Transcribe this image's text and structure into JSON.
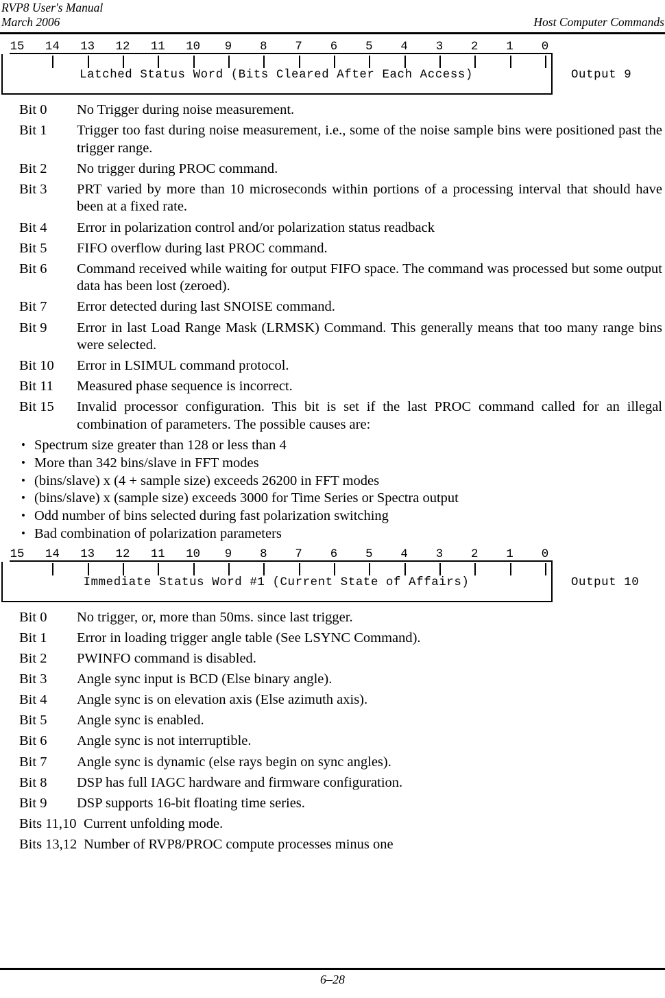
{
  "header": {
    "manual_title": "RVP8 User's Manual",
    "date": "March 2006",
    "section": "Host Computer Commands"
  },
  "footer": {
    "page_number": "6–28"
  },
  "diagram1": {
    "bit_numbers": [
      "15",
      "14",
      "13",
      "12",
      "11",
      "10",
      "9",
      "8",
      "7",
      "6",
      "5",
      "4",
      "3",
      "2",
      "1",
      "0"
    ],
    "label": "Latched Status Word (Bits Cleared After Each Access)",
    "output": "Output 9"
  },
  "diagram2": {
    "bit_numbers": [
      "15",
      "14",
      "13",
      "12",
      "11",
      "10",
      "9",
      "8",
      "7",
      "6",
      "5",
      "4",
      "3",
      "2",
      "1",
      "0"
    ],
    "label": "Immediate Status Word #1 (Current State of Affairs)",
    "output": "Output 10"
  },
  "latched_status_bits": [
    {
      "label": "Bit 0",
      "desc": "No Trigger during noise measurement."
    },
    {
      "label": "Bit 1",
      "desc": "Trigger too fast during noise measurement, i.e., some of the noise sample bins were positioned past the trigger range."
    },
    {
      "label": "Bit 2",
      "desc": "No trigger during PROC command."
    },
    {
      "label": "Bit 3",
      "desc": "PRT varied by more than 10 microseconds within portions of a processing interval that should have been at a fixed rate."
    },
    {
      "label": "Bit 4",
      "desc": "Error in polarization control and/or polarization status readback"
    },
    {
      "label": "Bit 5",
      "desc": "FIFO overflow during last PROC command."
    },
    {
      "label": "Bit 6",
      "desc": "Command received while waiting for output FIFO space.  The command was processed but some output data has been lost (zeroed)."
    },
    {
      "label": "Bit 7",
      "desc": "Error detected during last SNOISE command."
    },
    {
      "label": "Bit 9",
      "desc": "Error in last Load Range Mask (LRMSK) Command.  This generally means that too many range bins were selected."
    },
    {
      "label": "Bit 10",
      "desc": "Error in LSIMUL command protocol."
    },
    {
      "label": "Bit 11",
      "desc": "Measured phase sequence is incorrect."
    },
    {
      "label": "Bit 15",
      "desc": "Invalid processor configuration.  This bit is set if the last PROC command called for an illegal combination of parameters.  The possible causes are:"
    }
  ],
  "bit15_causes": [
    "Spectrum size greater than 128 or less than 4",
    "More than 342 bins/slave in FFT modes",
    "(bins/slave) x (4 + sample size) exceeds 26200 in FFT modes",
    "(bins/slave) x (sample size) exceeds 3000 for Time Series or Spectra output",
    "Odd number of bins selected during fast polarization switching",
    "Bad combination of polarization parameters"
  ],
  "immediate_status_bits": [
    {
      "label": "Bit 0",
      "desc": "No trigger, or, more than 50ms. since last trigger."
    },
    {
      "label": "Bit 1",
      "desc": "Error in loading trigger angle table (See LSYNC Command)."
    },
    {
      "label": "Bit 2",
      "desc": "PWINFO command is disabled."
    },
    {
      "label": "Bit 3",
      "desc": "Angle sync input is BCD (Else binary angle)."
    },
    {
      "label": "Bit 4",
      "desc": "Angle sync is on elevation axis (Else azimuth axis)."
    },
    {
      "label": "Bit 5",
      "desc": "Angle sync is enabled."
    },
    {
      "label": "Bit 6",
      "desc": "Angle sync is not interruptible."
    },
    {
      "label": "Bit 7",
      "desc": "Angle sync is dynamic (else rays begin on sync angles)."
    },
    {
      "label": "Bit 8",
      "desc": "DSP has full IAGC hardware and firmware configuration."
    },
    {
      "label": "Bit 9",
      "desc": "DSP supports 16-bit floating time series."
    },
    {
      "label": "Bits 11,10",
      "desc": "Current unfolding mode."
    },
    {
      "label": "Bits 13,12",
      "desc": "Number of RVP8/PROC compute processes minus one"
    }
  ]
}
